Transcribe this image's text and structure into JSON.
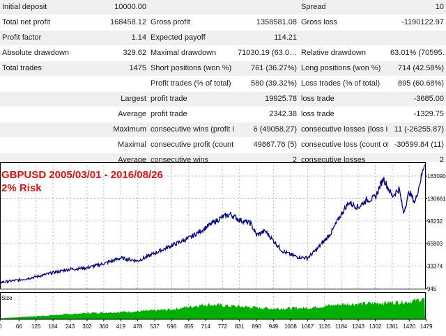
{
  "stats": {
    "rows": [
      [
        "Initial deposit",
        "10000.00",
        "",
        "",
        "Spread",
        "10"
      ],
      [
        "Total net profit",
        "168458.12",
        "Gross profit",
        "1358581.08",
        "Gross loss",
        "-1190122.97"
      ],
      [
        "Profit factor",
        "1.14",
        "Expected payoff",
        "114.21",
        "",
        ""
      ],
      [
        "Absolute drawdown",
        "329.62",
        "Maximal drawdown",
        "71030.19 (63.0…",
        "Relative drawdown",
        "63.01% (70595…"
      ],
      [
        "Total trades",
        "1475",
        "Short positions (won %)",
        "761 (36.27%)",
        "Long positions (won %)",
        "714 (42.58%)"
      ],
      [
        "",
        "",
        "Profit trades (% of total)",
        "580 (39.32%)",
        "Loss trades (% of total)",
        "895 (60.68%)"
      ],
      [
        "",
        "Largest",
        "profit trade",
        "19925.78",
        "loss trade",
        "-3685.00"
      ],
      [
        "",
        "Average",
        "profit trade",
        "2342.38",
        "loss trade",
        "-1329.75"
      ],
      [
        "",
        "Maximum",
        "consecutive wins (profit in …",
        "6 (49058.27)",
        "consecutive losses (loss in …",
        "11 (-26255.87)"
      ],
      [
        "",
        "Maximal",
        "consecutive profit (count o…",
        "49867.76 (5)",
        "consecutive loss (count of l…",
        "-30599.84 (11)"
      ],
      [
        "",
        "Average",
        "consecutive wins",
        "2",
        "consecutive losses",
        "2"
      ]
    ]
  },
  "chart_header": {
    "title": "GBPUSD 2005/03/01 - 2016/08/26",
    "subtitle": "2% Risk",
    "size_label": "Size",
    "title_color": "#e01010"
  },
  "chart_data": {
    "type": "line",
    "balance_color": "#00008b",
    "volume_color": "#00b000",
    "y_ticks": [
      945,
      33374,
      65803,
      98232,
      130661,
      163090
    ],
    "ylim": [
      945,
      163090
    ],
    "x_ticks": [
      0,
      66,
      125,
      184,
      243,
      302,
      360,
      419,
      478,
      537,
      596,
      655,
      714,
      772,
      831,
      890,
      949,
      1008,
      1067,
      1126,
      1184,
      1243,
      1302,
      1361,
      1420,
      1479
    ],
    "xlim": [
      0,
      1475
    ],
    "balance_points": [
      [
        0,
        10000
      ],
      [
        66,
        13500
      ],
      [
        125,
        18000
      ],
      [
        184,
        24000
      ],
      [
        243,
        29000
      ],
      [
        302,
        31000
      ],
      [
        360,
        37000
      ],
      [
        419,
        45000
      ],
      [
        478,
        41000
      ],
      [
        537,
        52000
      ],
      [
        596,
        63000
      ],
      [
        655,
        73500
      ],
      [
        700,
        85000
      ],
      [
        740,
        96000
      ],
      [
        772,
        104000
      ],
      [
        800,
        108000
      ],
      [
        831,
        100000
      ],
      [
        870,
        95000
      ],
      [
        890,
        78000
      ],
      [
        920,
        84000
      ],
      [
        949,
        70000
      ],
      [
        980,
        55000
      ],
      [
        1008,
        50000
      ],
      [
        1030,
        47000
      ],
      [
        1067,
        45000
      ],
      [
        1100,
        58000
      ],
      [
        1126,
        70000
      ],
      [
        1150,
        82000
      ],
      [
        1184,
        108000
      ],
      [
        1210,
        125000
      ],
      [
        1243,
        118000
      ],
      [
        1270,
        128000
      ],
      [
        1302,
        132000
      ],
      [
        1330,
        160000
      ],
      [
        1361,
        134000
      ],
      [
        1385,
        145000
      ],
      [
        1400,
        110000
      ],
      [
        1420,
        140000
      ],
      [
        1440,
        125000
      ],
      [
        1455,
        150000
      ],
      [
        1475,
        185000
      ]
    ],
    "volume_points": [
      [
        0,
        0.05
      ],
      [
        125,
        0.15
      ],
      [
        302,
        0.3
      ],
      [
        478,
        0.38
      ],
      [
        596,
        0.48
      ],
      [
        714,
        0.72
      ],
      [
        831,
        0.62
      ],
      [
        949,
        0.52
      ],
      [
        1067,
        0.55
      ],
      [
        1184,
        0.72
      ],
      [
        1302,
        0.78
      ],
      [
        1420,
        0.85
      ],
      [
        1475,
        1.0
      ]
    ]
  }
}
